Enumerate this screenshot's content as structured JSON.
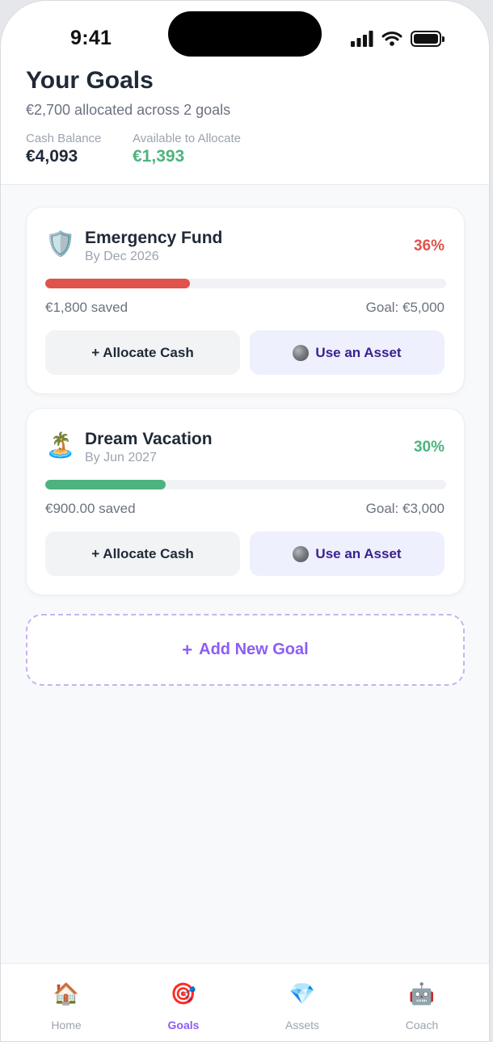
{
  "status_bar": {
    "time": "9:41"
  },
  "header": {
    "title": "Your Goals",
    "subtitle": "€2,700 allocated across 2 goals",
    "cash_balance_label": "Cash Balance",
    "cash_balance_value": "€4,093",
    "available_label": "Available to Allocate",
    "available_value": "€1,393"
  },
  "goals": [
    {
      "icon": "shield-emoji-icon",
      "emoji": "🛡️",
      "title": "Emergency Fund",
      "date": "By Dec 2026",
      "percent": "36%",
      "progress": 0.36,
      "color": "#e0524a",
      "saved": "€1,800 saved",
      "goal": "Goal: €5,000",
      "allocate_label": "+ Allocate Cash",
      "asset_label": "Use an Asset"
    },
    {
      "icon": "beach-umbrella-icon",
      "emoji": "🏝️",
      "title": "Dream Vacation",
      "date": "By Jun 2027",
      "percent": "30%",
      "progress": 0.3,
      "color": "#4db37e",
      "saved": "€900.00 saved",
      "goal": "Goal: €3,000",
      "allocate_label": "+ Allocate Cash",
      "asset_label": "Use an Asset"
    }
  ],
  "add_goal": {
    "plus": "+",
    "label": "Add New Goal"
  },
  "tabs": [
    {
      "label": "Home",
      "emoji": "🏠",
      "icon": "house-icon",
      "active": false
    },
    {
      "label": "Goals",
      "emoji": "🎯",
      "icon": "target-icon",
      "active": true
    },
    {
      "label": "Assets",
      "emoji": "💎",
      "icon": "gem-icon",
      "active": false
    },
    {
      "label": "Coach",
      "emoji": "🤖",
      "icon": "robot-icon",
      "active": false
    }
  ],
  "colors": {
    "accent": "#8b5cf6",
    "positive": "#4db37e",
    "danger": "#e0524a"
  }
}
